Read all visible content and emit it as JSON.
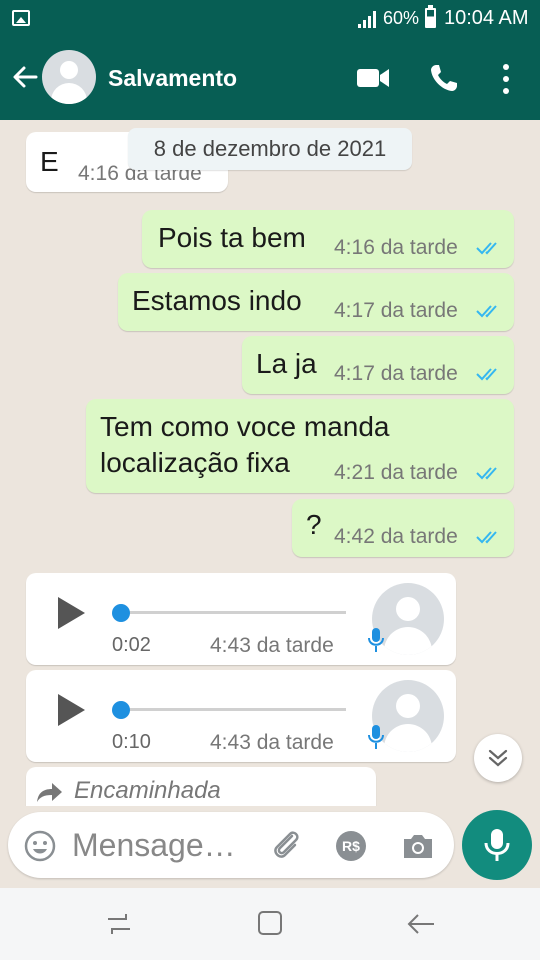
{
  "status_bar": {
    "battery": "60%",
    "time": "10:04 AM",
    "icons": [
      "image-icon",
      "signal-icon",
      "battery-icon"
    ]
  },
  "header": {
    "contact_name": "Salvamento",
    "icons": [
      "back-arrow-icon",
      "avatar-icon",
      "video-call-icon",
      "phone-icon",
      "more-vert-icon"
    ]
  },
  "date_chip": "8 de dezembro de 2021",
  "messages": [
    {
      "dir": "in",
      "text": "E",
      "time": "4:16 da tarde"
    },
    {
      "dir": "out",
      "text": "Pois ta bem",
      "time": "4:16 da tarde",
      "status": "read"
    },
    {
      "dir": "out",
      "text": "Estamos indo",
      "time": "4:17 da tarde",
      "status": "read"
    },
    {
      "dir": "out",
      "text": "La ja",
      "time": "4:17 da tarde",
      "status": "read"
    },
    {
      "dir": "out",
      "text_line1": "Tem como voce manda",
      "text_line2": "localização fixa",
      "time": "4:21 da tarde",
      "status": "read"
    },
    {
      "dir": "out",
      "text": "?",
      "time": "4:42 da tarde",
      "status": "read"
    }
  ],
  "audio_messages": [
    {
      "duration": "0:02",
      "time": "4:43 da tarde"
    },
    {
      "duration": "0:10",
      "time": "4:43 da tarde"
    }
  ],
  "forwarded_label": "Encaminhada",
  "input": {
    "placeholder": "Mensage…"
  },
  "colors": {
    "header": "#075E54",
    "outgoing": "#DCF8C6",
    "incoming": "#FFFFFF",
    "chat_bg": "#ECE5DD",
    "accent": "#128C7E",
    "tick": "#34B7F1"
  }
}
